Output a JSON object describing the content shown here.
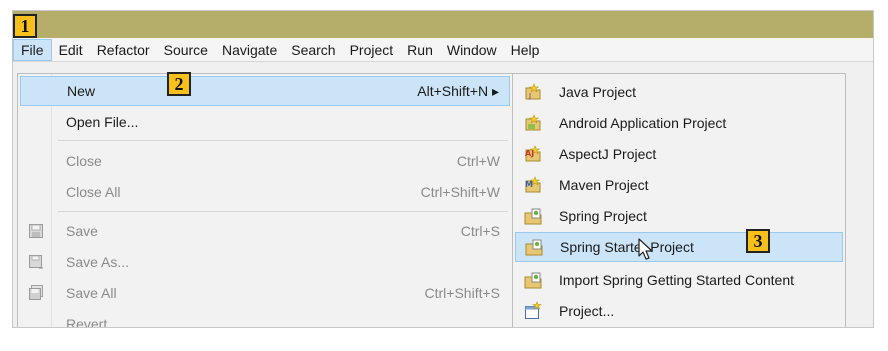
{
  "menubar": {
    "items": [
      "File",
      "Edit",
      "Refactor",
      "Source",
      "Navigate",
      "Search",
      "Project",
      "Run",
      "Window",
      "Help"
    ]
  },
  "badges": {
    "b1": "1",
    "b2": "2",
    "b3": "3"
  },
  "file_menu": {
    "new": {
      "label": "New",
      "accel": "Alt+Shift+N ▸"
    },
    "open_file": {
      "label": "Open File..."
    },
    "close": {
      "label": "Close",
      "accel": "Ctrl+W"
    },
    "close_all": {
      "label": "Close All",
      "accel": "Ctrl+Shift+W"
    },
    "save": {
      "label": "Save",
      "accel": "Ctrl+S"
    },
    "save_as": {
      "label": "Save As..."
    },
    "save_all": {
      "label": "Save All",
      "accel": "Ctrl+Shift+S"
    },
    "revert": {
      "label": "Revert"
    }
  },
  "new_submenu": {
    "items": [
      {
        "label": "Java Project",
        "icon": "java-project-icon"
      },
      {
        "label": "Android Application Project",
        "icon": "android-project-icon"
      },
      {
        "label": "AspectJ Project",
        "icon": "aspectj-project-icon"
      },
      {
        "label": "Maven Project",
        "icon": "maven-project-icon"
      },
      {
        "label": "Spring Project",
        "icon": "spring-project-icon"
      },
      {
        "label": "Spring Starter Project",
        "icon": "spring-starter-icon"
      },
      {
        "label": "Import Spring Getting Started Content",
        "icon": "spring-import-icon"
      },
      {
        "label": "Project...",
        "icon": "generic-project-icon"
      }
    ]
  },
  "colors": {
    "title_bar": "#b5ae6b",
    "highlight": "#cce4f7",
    "highlight_border": "#99c9ef",
    "badge": "#f8c01a"
  }
}
